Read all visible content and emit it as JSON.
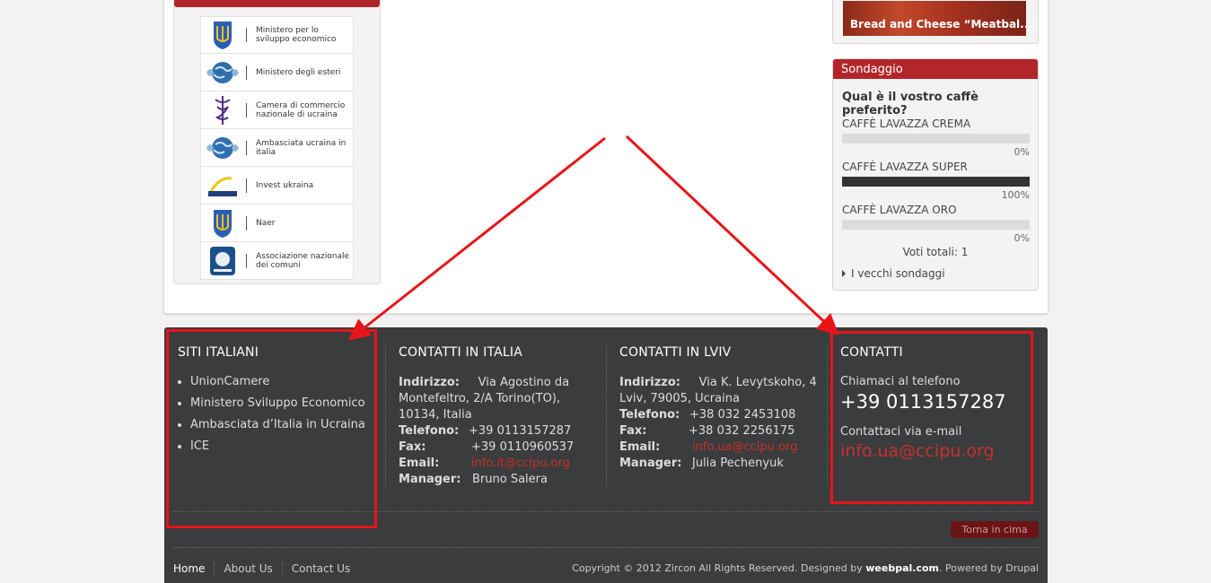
{
  "colors": {
    "accent_red": "#b2262a",
    "footer_bg": "#3a3c3e",
    "annotation": "#e8141a"
  },
  "left_block": {
    "logos": [
      {
        "icon": "trident-icon",
        "label": "Ministero per lo sviluppo economico"
      },
      {
        "icon": "globe-icon",
        "label": "Ministero degli esteri"
      },
      {
        "icon": "caduceus-icon",
        "label": "Camera di commercio nazionale di ucraina"
      },
      {
        "icon": "globe-icon",
        "label": "Ambasciata ucraina in italia"
      },
      {
        "icon": "invest-logo-icon",
        "label": "Invest ukraina"
      },
      {
        "icon": "trident-icon",
        "label": "Naer"
      },
      {
        "icon": "emblem-icon",
        "label": "Associazione nazionale dei comuni"
      }
    ]
  },
  "food": {
    "caption": "Bread and Cheese “Meatbal..."
  },
  "poll": {
    "title": "Sondaggio",
    "question": "Qual è il vostro caffè preferito?",
    "options": [
      {
        "label": "CAFFÈ LAVAZZA CREMA",
        "percent": 0,
        "percent_text": "0%"
      },
      {
        "label": "CAFFÈ LAVAZZA SUPER",
        "percent": 100,
        "percent_text": "100%"
      },
      {
        "label": "CAFFÈ LAVAZZA ORO",
        "percent": 0,
        "percent_text": "0%"
      }
    ],
    "total": "Voti totali: 1",
    "old_polls": "I vecchi sondaggi"
  },
  "footer": {
    "col1": {
      "title": "SITI ITALIANI",
      "links": [
        "UnionCamere",
        "Ministero Sviluppo Economico",
        "Ambasciata d’Italia in Ucraina",
        "ICE"
      ]
    },
    "col2": {
      "title": "CONTATTI IN ITALIA",
      "address_label": "Indirizzo:",
      "address": "Via Agostino da Montefeltro, 2/A Torino(TO), 10134, Italia",
      "phone_label": "Telefono:",
      "phone": "+39 0113157287",
      "fax_label": "Fax:",
      "fax": "+39 0110960537",
      "email_label": "Email:",
      "email": "info.it@ccipu.org",
      "manager_label": "Manager:",
      "manager": "Bruno Salera"
    },
    "col3": {
      "title": "CONTATTI IN LVIV",
      "address_label": "Indirizzo:",
      "address": "Via K. Levytskoho, 4 Lviv, 79005, Ucraina",
      "phone_label": "Telefono:",
      "phone": "+38 032 2453108",
      "fax_label": "Fax:",
      "fax": "+38 032 2256175",
      "email_label": "Email:",
      "email": "info.ua@ccipu.org",
      "manager_label": "Manager:",
      "manager": "Julia Pechenyuk"
    },
    "col4": {
      "title": "CONTATTI",
      "call_label": "Chiamaci al telefono",
      "phone": "+39 0113157287",
      "mail_label": "Contattaci via e-mail",
      "email": "info.ua@ccipu.org"
    },
    "back_to_top": "Torna in cima",
    "nav": [
      "Home",
      "About Us",
      "Contact Us"
    ],
    "copyright_pre": "Copyright © 2012 Zircon All Rights Reserved. Designed by ",
    "copyright_brand": "weebpal.com",
    "copyright_post": ". Powered by Drupal"
  }
}
